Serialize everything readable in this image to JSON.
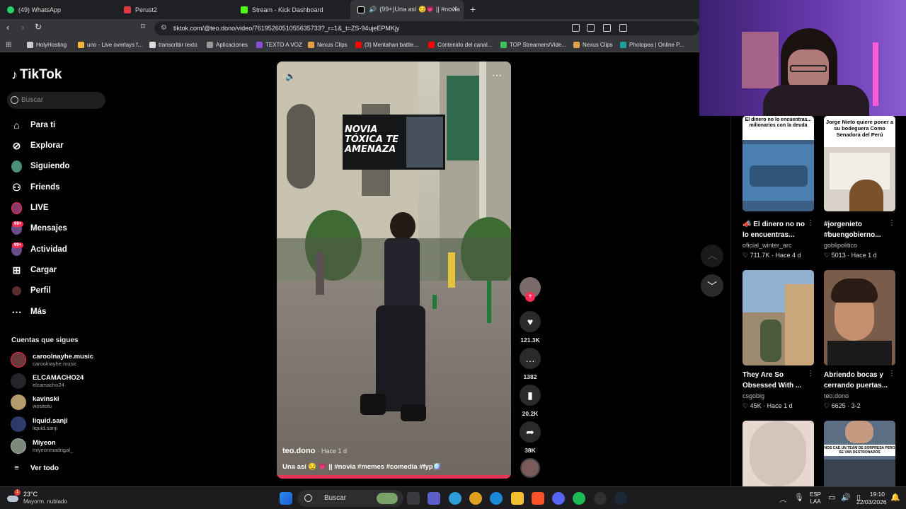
{
  "browser": {
    "tabs": [
      {
        "label": "(49) WhatsApp",
        "color": "#25d366"
      },
      {
        "label": "Perust2",
        "color": "#e0383e"
      },
      {
        "label": "Stream - Kick Dashboard",
        "color": "#53fc18"
      },
      {
        "label": "(99+)Una así 😏💗 || #novia",
        "color": "#ffffff"
      }
    ],
    "url": "tiktok.com/@teo.dono/video/7619526051055635733?_r=1&_t=ZS-94ujeEPMKjy",
    "bookmarks": [
      {
        "label": "HolyHosting",
        "color": "#cccccc"
      },
      {
        "label": "uno - Live overlays f...",
        "color": "#f3b63b"
      },
      {
        "label": "transcribir texto",
        "color": "#dddddd"
      },
      {
        "label": "Aplicaciones",
        "color": "#9a9a9a"
      },
      {
        "label": "TEXTO A VOZ",
        "color": "#8a4dd6"
      },
      {
        "label": "Nexus Clips",
        "color": "#e5a04a"
      },
      {
        "label": "(3) Mentahan battle...",
        "color": "#ff0000"
      },
      {
        "label": "Contenido del canal...",
        "color": "#ff0000"
      },
      {
        "label": "TOP Streamers/Vide...",
        "color": "#3fbf5a"
      },
      {
        "label": "Nexus Clips",
        "color": "#e5a04a"
      },
      {
        "label": "Photopea | Online P...",
        "color": "#18a497"
      }
    ]
  },
  "tiktok": {
    "logo": "TikTok",
    "search_placeholder": "Buscar",
    "nav": [
      {
        "label": "Para ti",
        "icon": "home-icon"
      },
      {
        "label": "Explorar",
        "icon": "compass-icon"
      },
      {
        "label": "Siguiendo",
        "icon": "following-avatar"
      },
      {
        "label": "Friends",
        "icon": "friends-icon"
      },
      {
        "label": "LIVE",
        "icon": "live-avatar"
      },
      {
        "label": "Mensajes",
        "icon": "messages-avatar",
        "badge": "99+"
      },
      {
        "label": "Actividad",
        "icon": "activity-avatar",
        "badge": "99+"
      },
      {
        "label": "Cargar",
        "icon": "upload-icon"
      },
      {
        "label": "Perfil",
        "icon": "profile-avatar"
      },
      {
        "label": "Más",
        "icon": "more-icon"
      }
    ],
    "following_title": "Cuentas que sigues",
    "following": [
      {
        "name": "caroolnayhe.music",
        "handle": "caroolnayhe.music"
      },
      {
        "name": "ELCAMACHO24",
        "handle": "elcamacho24"
      },
      {
        "name": "kavinski",
        "handle": "wositolu"
      },
      {
        "name": "liquid.sanji",
        "handle": "liquid.sanji"
      },
      {
        "name": "Miyeon",
        "handle": "miyeonmadrigal_"
      }
    ],
    "see_all": "Ver todo",
    "video": {
      "overlay_text": "NOVIA TÓXICA TE AMENAZA",
      "author": "teo.dono",
      "time": "· Hace 1 d",
      "caption": "Una así 😏 💗 || #novia #memes #comedia #fyp🪩"
    },
    "actions": [
      {
        "label": "121.3K",
        "icon": "heart-icon"
      },
      {
        "label": "1382",
        "icon": "comment-icon"
      },
      {
        "label": "20.2K",
        "icon": "bookmark-icon"
      },
      {
        "label": "38K",
        "icon": "share-icon"
      }
    ],
    "recommended": [
      {
        "thumb_text": "El dinero no lo encuentras... milionarios con la deuda",
        "title": "📣 El dinero no no lo encuentras...",
        "user": "oficial_winter_arc",
        "likes": "711.7K",
        "time": "Hace 4 d",
        "bg": "#3b5f85"
      },
      {
        "thumb_text": "Jorge Nieto quiere poner a su bodeguera Como Senadora del Perú",
        "title": "#jorgenieto #buengobierno...",
        "user": "goblipolitico",
        "likes": "5013",
        "time": "Hace 1 d",
        "bg": "#d9d2c8"
      },
      {
        "thumb_text": "",
        "title": "They Are So Obsessed With ...",
        "user": "csgobig",
        "likes": "45K",
        "time": "Hace 1 d",
        "bg": "#9c8b6e"
      },
      {
        "thumb_text": "",
        "title": "Abriendo bocas y cerrando puertas...",
        "user": "teo.dono",
        "likes": "6625",
        "time": "3-2",
        "bg": "#7a5c4a"
      },
      {
        "thumb_text": "",
        "title": "",
        "user": "",
        "likes": "",
        "time": "",
        "bg": "#e6d8cf"
      },
      {
        "thumb_text": "NOS CAE UN TEAM DE SORPRESA PERO SE VAN DESTRONADOS",
        "title": "",
        "user": "",
        "likes": "",
        "time": "",
        "bg": "#5b6e84"
      }
    ]
  },
  "taskbar": {
    "weather_temp": "23°C",
    "weather_desc": "Mayorm. nublado",
    "search": "Buscar",
    "lang1": "ESP",
    "lang2": "LAA",
    "time": "19:10",
    "date": "22/03/2026"
  }
}
